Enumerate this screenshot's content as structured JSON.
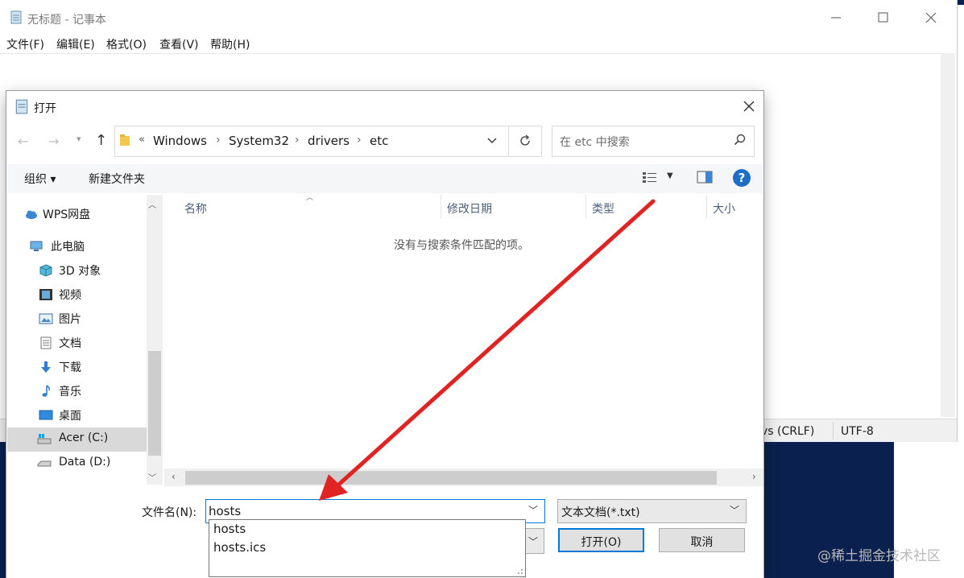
{
  "notepad": {
    "title": "无标题 - 记事本",
    "menu": [
      "文件(F)",
      "编辑(E)",
      "格式(O)",
      "查看(V)",
      "帮助(H)"
    ],
    "status_eol": "vs (CRLF)",
    "status_encoding": "UTF-8"
  },
  "dialog": {
    "title": "打开",
    "address": {
      "overflow": "«",
      "crumbs": [
        "Windows",
        "System32",
        "drivers",
        "etc"
      ]
    },
    "search_placeholder": "在 etc 中搜索",
    "toolbar": {
      "organize": "组织 ▾",
      "new_folder": "新建文件夹",
      "help": "?"
    },
    "nav_items": [
      {
        "label": "WPS网盘",
        "icon": "cloud-icon"
      },
      {
        "label": "此电脑",
        "icon": "computer-icon"
      },
      {
        "label": "3D 对象",
        "icon": "cube-icon"
      },
      {
        "label": "视频",
        "icon": "video-icon"
      },
      {
        "label": "图片",
        "icon": "picture-icon"
      },
      {
        "label": "文档",
        "icon": "document-icon"
      },
      {
        "label": "下载",
        "icon": "download-icon"
      },
      {
        "label": "音乐",
        "icon": "music-icon"
      },
      {
        "label": "桌面",
        "icon": "desktop-icon"
      },
      {
        "label": "Acer (C:)",
        "icon": "drive-c-icon",
        "selected": true
      },
      {
        "label": "Data (D:)",
        "icon": "drive-d-icon"
      }
    ],
    "columns": [
      "名称",
      "修改日期",
      "类型",
      "大小"
    ],
    "empty_message": "没有与搜索条件匹配的项。",
    "filename_label": "文件名(N):",
    "filename_value": "hosts",
    "filetype_value": "文本文档(*.txt)",
    "open_label": "打开(O)",
    "cancel_label": "取消",
    "autocomplete": [
      "hosts",
      "hosts.ics"
    ]
  },
  "watermark": "@稀土掘金技术社区",
  "colors": {
    "accent": "#0078d7",
    "arrow": "#e02424"
  }
}
